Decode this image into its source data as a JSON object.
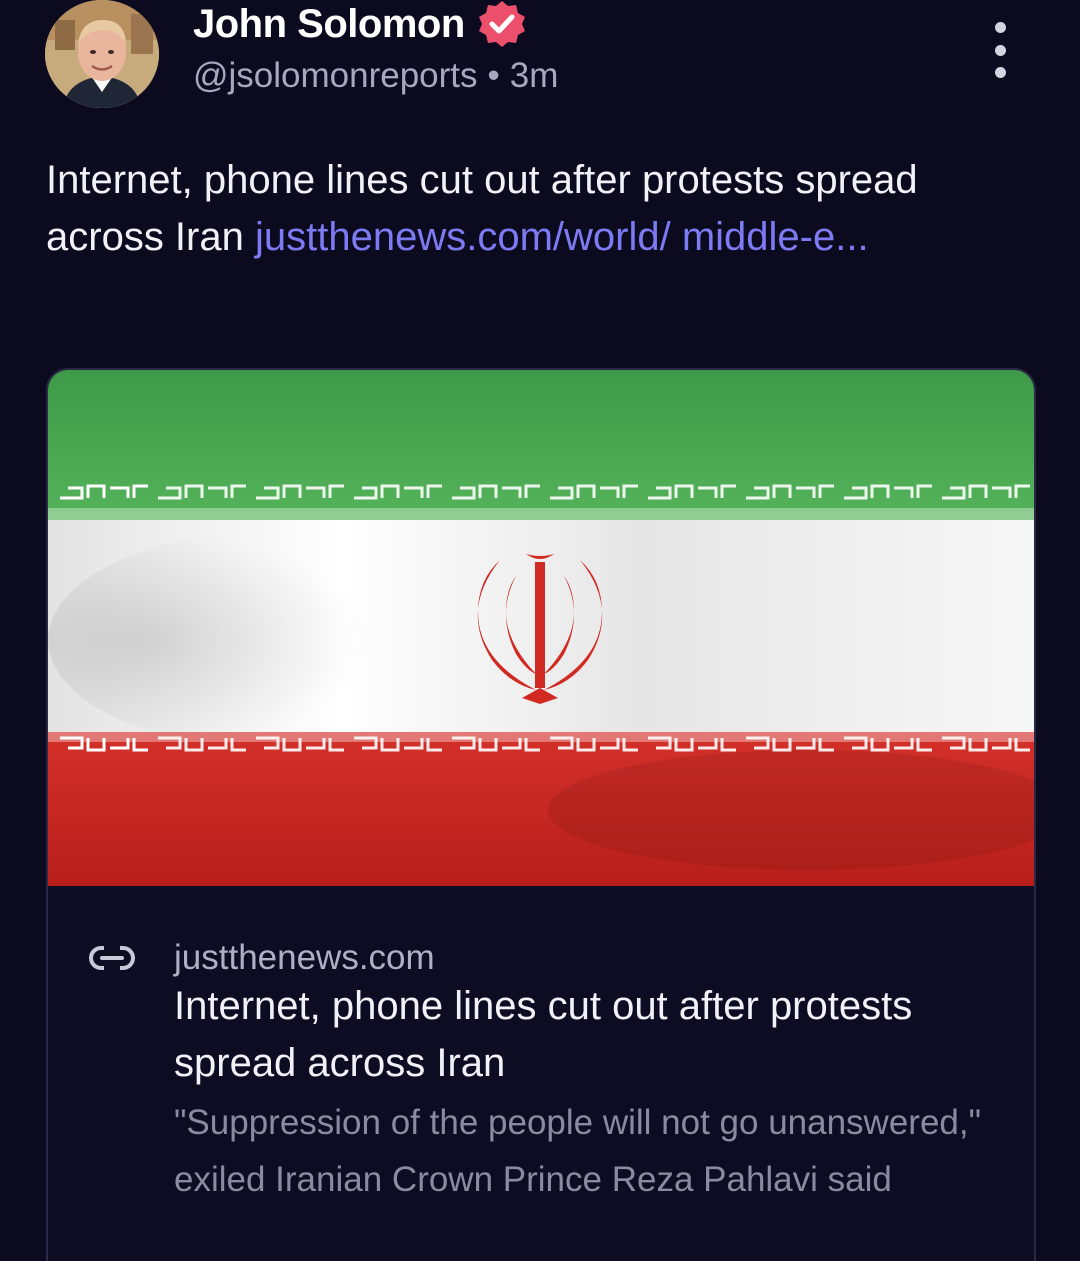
{
  "author": {
    "display_name": "John Solomon",
    "handle": "@jsolomonreports",
    "separator": "•",
    "time_ago": "3m",
    "avatar_icon": "profile-photo",
    "verified_icon": "verified-badge-icon"
  },
  "post": {
    "text": "Internet, phone lines cut out after protests spread across Iran",
    "link_text": "justthenews.com/world/ middle-e..."
  },
  "link_card": {
    "image_icon": "iran-flag-image",
    "link_icon": "link-icon",
    "domain": "justthenews.com",
    "title": "Internet, phone lines cut out after protests spread across Iran",
    "description": "\"Suppression of the people will not go unanswered,\" exiled Iranian Crown Prince Reza Pahlavi said"
  },
  "menu": {
    "icon": "more-vertical-icon"
  },
  "colors": {
    "background": "#0b0a1f",
    "link": "#7d7bf4",
    "verified_badge": "#ec4f6b",
    "flag_green": "#3fa14a",
    "flag_white": "#f4f4f4",
    "flag_red": "#d02a22"
  }
}
